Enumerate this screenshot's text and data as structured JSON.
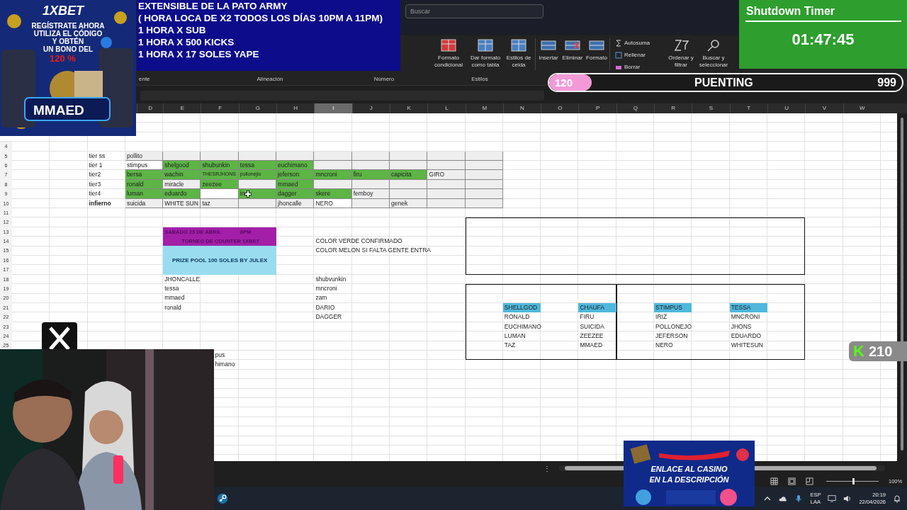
{
  "promo_ad": {
    "brand": "1XBET",
    "lines": [
      "REGÍSTRATE AHORA",
      "UTILIZA EL CÓDIGO",
      "Y OBTÉN",
      "UN BONO DEL"
    ],
    "bonus": "120 %",
    "code": "MMAED"
  },
  "stream_notice": {
    "lines": [
      "EXTENSIBLE  DE LA PATO ARMY",
      "( HORA LOCA DE X2 TODOS LOS DÍAS 10PM A 11PM)",
      "1 HORA X SUB",
      "1 HORA X 500 KICKS",
      "1 HORA X 17 SOLES YAPE"
    ]
  },
  "shutdown_timer": {
    "title": "Shutdown Timer",
    "time": "01:47:45"
  },
  "goal_bar": {
    "count": "120",
    "title": "PUENTING",
    "target": "999",
    "level": 0.12
  },
  "search": {
    "placeholder": "Buscar"
  },
  "ribbon": {
    "styles_buttons": [
      "Formato condicional",
      "Dar formato como tabla",
      "Estilos de celda"
    ],
    "cells_buttons": [
      "Insertar",
      "Eliminar",
      "Formato"
    ],
    "editing_small": [
      "Autosuma",
      "Rellenar",
      "Borrar"
    ],
    "editing_buttons": [
      "Ordenar y filtrar",
      "Buscar y seleccionar"
    ],
    "group_labels": [
      "ente",
      "Alineación",
      "Número",
      "Estilos"
    ]
  },
  "columns": [
    {
      "label": "D",
      "selected": false
    },
    {
      "label": "E",
      "selected": false
    },
    {
      "label": "F",
      "selected": false
    },
    {
      "label": "G",
      "selected": false
    },
    {
      "label": "H",
      "selected": false
    },
    {
      "label": "I",
      "selected": true
    },
    {
      "label": "J",
      "selected": false
    },
    {
      "label": "K",
      "selected": false
    },
    {
      "label": "L",
      "selected": false
    },
    {
      "label": "M",
      "selected": false
    },
    {
      "label": "N",
      "selected": false
    },
    {
      "label": "O",
      "selected": false
    },
    {
      "label": "P",
      "selected": false
    },
    {
      "label": "Q",
      "selected": false
    },
    {
      "label": "R",
      "selected": false
    },
    {
      "label": "S",
      "selected": false
    },
    {
      "label": "T",
      "selected": false
    },
    {
      "label": "U",
      "selected": false
    },
    {
      "label": "V",
      "selected": false
    },
    {
      "label": "W",
      "selected": false
    }
  ],
  "row_numbers": [
    "4",
    "5",
    "6",
    "7",
    "8",
    "9",
    "10",
    "11",
    "12",
    "13",
    "14",
    "15",
    "16",
    "17",
    "18",
    "19",
    "20",
    "21",
    "22",
    "23",
    "24",
    "25"
  ],
  "tier_table": [
    {
      "label": "tier ss",
      "bold": false,
      "cells": [
        {
          "text": "pollito",
          "color": "#eeeeee"
        },
        {
          "color": "#eeeeee"
        },
        {
          "color": "#eeeeee"
        },
        {
          "color": "#eeeeee"
        },
        {
          "color": "#eeeeee"
        },
        {
          "color": "#eeeeee"
        },
        {
          "color": "#eeeeee"
        },
        {
          "color": "#eeeeee"
        },
        {
          "color": "#eeeeee"
        },
        {
          "color": "#eeeeee"
        }
      ]
    },
    {
      "label": "tier 1",
      "bold": false,
      "cells": [
        {
          "text": "stimpus",
          "color": "#ffffff"
        },
        {
          "text": "shelgood",
          "color": "#5cb545"
        },
        {
          "text": "shubunkin",
          "color": "#5cb545"
        },
        {
          "text": "tessa",
          "color": "#5cb545"
        },
        {
          "text": "euchimano",
          "color": "#5cb545"
        },
        {
          "color": "#eeeeee"
        },
        {
          "color": "#eeeeee"
        },
        {
          "color": "#eeeeee"
        },
        {
          "color": "#eeeeee"
        },
        {
          "color": "#eeeeee"
        }
      ]
    },
    {
      "label": "tier2",
      "bold": false,
      "cells": [
        {
          "text": "bersa",
          "color": "#5cb545"
        },
        {
          "text": "wachin",
          "color": "#5cb545"
        },
        {
          "text": "THESRJHONS",
          "color": "#5cb545"
        },
        {
          "text": "pollonejio",
          "color": "#5cb545"
        },
        {
          "text": "jeferson",
          "color": "#5cb545"
        },
        {
          "text": "mncroni",
          "color": "#5cb545"
        },
        {
          "text": "firu",
          "color": "#5cb545"
        },
        {
          "text": "capicita",
          "color": "#5cb545"
        },
        {
          "text": "GIRO",
          "color": "#eeeeee"
        },
        {
          "color": "#eeeeee"
        }
      ]
    },
    {
      "label": "tier3",
      "bold": false,
      "cells": [
        {
          "text": "ronald",
          "color": "#5cb545"
        },
        {
          "text": "miracle",
          "color": "#eeeeee"
        },
        {
          "text": "zeezee",
          "color": "#5cb545"
        },
        {
          "color": "#eeeeee"
        },
        {
          "text": "mmaed",
          "color": "#5cb545"
        },
        {
          "color": "#eeeeee"
        },
        {
          "color": "#eeeeee"
        },
        {
          "color": "#eeeeee"
        },
        {
          "color": "#eeeeee"
        },
        {
          "color": "#eeeeee"
        }
      ]
    },
    {
      "label": "tier4",
      "bold": false,
      "cells": [
        {
          "text": "luman",
          "color": "#5cb545"
        },
        {
          "text": "eduardo",
          "color": "#5cb545"
        },
        {
          "color": "#ffffff"
        },
        {
          "text": "in",
          "color": "#5cb545"
        },
        {
          "text": "dagger",
          "color": "#5cb545"
        },
        {
          "text": "skere",
          "color": "#5cb545"
        },
        {
          "text": "femboy",
          "color": "#eeeeee"
        },
        {
          "color": "#eeeeee"
        },
        {
          "color": "#eeeeee"
        },
        {
          "color": "#eeeeee"
        }
      ]
    },
    {
      "label": "infierno",
      "bold": true,
      "cells": [
        {
          "text": "suicida",
          "color": "#eeeeee"
        },
        {
          "text": "WHITE SUN",
          "color": "#eeeeee"
        },
        {
          "text": "taz",
          "color": "#eeeeee"
        },
        {
          "color": "#eeeeee"
        },
        {
          "text": "jhoncalle",
          "color": "#eeeeee"
        },
        {
          "text": "NERO",
          "color": "#ffffff"
        },
        {
          "color": "#eeeeee"
        },
        {
          "text": "genek",
          "color": "#eeeeee"
        },
        {
          "color": "#eeeeee"
        },
        {
          "color": "#eeeeee"
        }
      ]
    }
  ],
  "tournament": {
    "date": "SABADO 25 DE ABRIL",
    "time": "8PM",
    "title": "TORNEO DE COUNTER  1XBET",
    "prize": "PRIZE POOL 100 SOLES BY JULEX",
    "notes": [
      "COLOR VERDE CONFIRMADO",
      "COLOR MELON SI FALTA GENTE ENTRA"
    ],
    "list_left": [
      "JHONCALLE",
      "tessa",
      "mmaed",
      "ronald"
    ],
    "list_right": [
      "shubvunkin",
      "mncroni",
      "zam",
      "DARIO",
      "DAGGER"
    ]
  },
  "cut_names": [
    "pus",
    "himano"
  ],
  "teams": [
    {
      "name": "SHELLGOD",
      "members": [
        "RONALD",
        "EUCHIMANO",
        "LUMAN",
        "TAZ"
      ]
    },
    {
      "name": "CHAUFA",
      "members": [
        "FIRU",
        "SUICIDA",
        "ZEEZEE",
        "MMAED"
      ]
    },
    {
      "name": "STIMPUS",
      "members": [
        "IRIZ",
        "POLLONEJO",
        "JEFERSON",
        "NERO"
      ]
    },
    {
      "name": "TESSA",
      "members": [
        "MNCRONI",
        "JHONS",
        "EDUARDO",
        "WHITESUN"
      ]
    }
  ],
  "kick_badge": {
    "icon": "K",
    "count": "210"
  },
  "casino_ad": {
    "lines": [
      "ENLACE AL CASINO",
      "EN LA DESCRIPCIÓN"
    ]
  },
  "status_bar": {
    "more": "⋮",
    "zoom": "100%",
    "zoom_slider": {
      "level": 0.5
    }
  },
  "taskbar": {
    "language": "ESP",
    "layout": "LAA",
    "time": "20:19",
    "date": "22/04/2026"
  }
}
